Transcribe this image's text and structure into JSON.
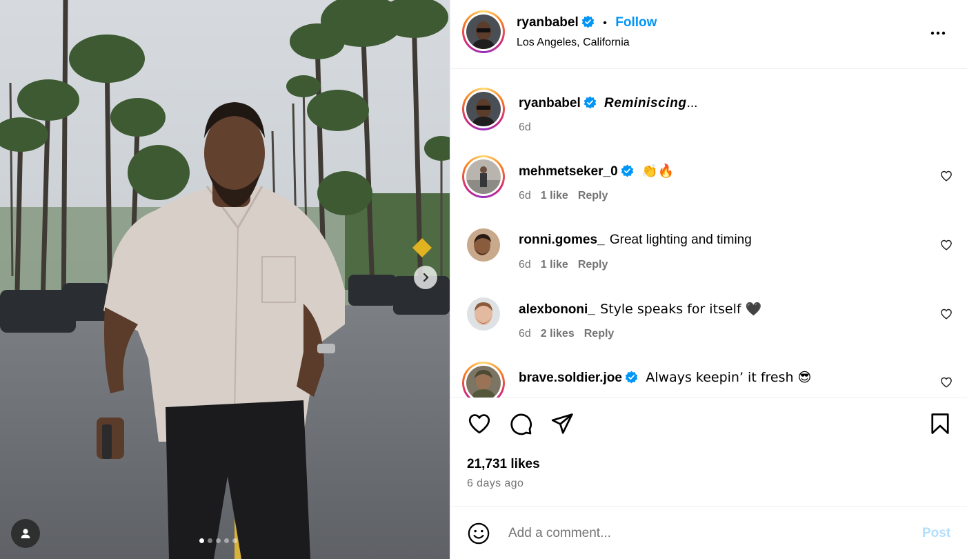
{
  "post": {
    "author": "ryanbabel",
    "follow_label": "Follow",
    "separator": "•",
    "location": "Los Angeles, California",
    "carousel": {
      "total": 5,
      "active": 1
    }
  },
  "caption": {
    "username": "ryanbabel",
    "text": "Reminiscing",
    "ellipsis": "...",
    "time": "6d"
  },
  "comments": [
    {
      "username": "mehmetseker_0",
      "verified": true,
      "text": "👏🔥",
      "time": "6d",
      "likes": "1 like",
      "reply": "Reply"
    },
    {
      "username": "ronni.gomes_",
      "verified": false,
      "text": "Great lighting and timing",
      "time": "6d",
      "likes": "1 like",
      "reply": "Reply"
    },
    {
      "username": "alexbononi_",
      "verified": false,
      "text": "Style speaks for itself 🖤",
      "time": "6d",
      "likes": "2 likes",
      "reply": "Reply"
    },
    {
      "username": "brave.soldier.joe",
      "verified": true,
      "text": "Always keepin’ it fresh 😎",
      "time": "",
      "likes": "",
      "reply": ""
    }
  ],
  "stats": {
    "likes": "21,731 likes",
    "posted": "6 days ago"
  },
  "composer": {
    "placeholder": "Add a comment...",
    "post_label": "Post"
  },
  "colors": {
    "accent": "#0095f6",
    "verified": "#0095f6",
    "muted": "#737373",
    "post_disabled": "#b2dffc"
  },
  "icons": [
    "more-icon",
    "heart-icon",
    "comment-icon",
    "share-icon",
    "bookmark-icon",
    "emoji-icon",
    "chevron-right-icon",
    "user-tag-icon",
    "verified-badge-icon"
  ]
}
